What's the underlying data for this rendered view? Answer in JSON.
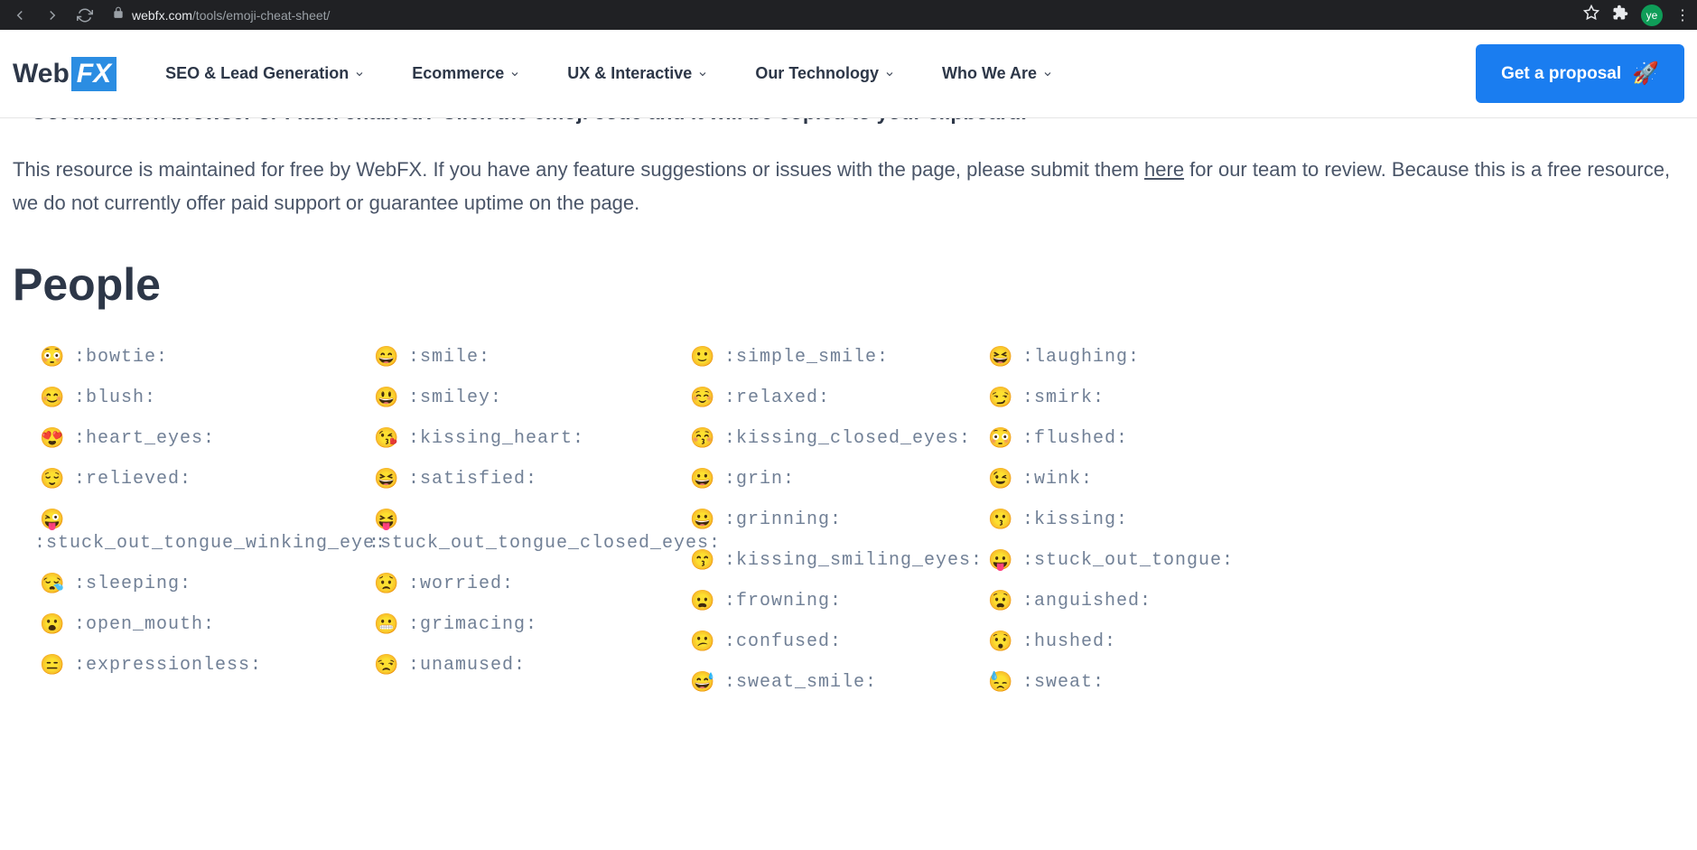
{
  "browser": {
    "url_domain": "webfx.com",
    "url_path": "/tools/emoji-cheat-sheet/",
    "avatar": "ye"
  },
  "header": {
    "logo_web": "Web",
    "logo_fx": "FX",
    "nav": [
      "SEO & Lead Generation",
      "Ecommerce",
      "UX & Interactive",
      "Our Technology",
      "Who We Are"
    ],
    "cta": "Get a proposal"
  },
  "content": {
    "clipped_text": "> Got a modern browser or Flash enabled? Click the emoji code and it will be copied to your clipboard.",
    "intro_part1": "This resource is maintained for free by WebFX. If you have any feature suggestions or issues with the page, please submit them ",
    "intro_link": "here",
    "intro_part2": " for our team to review. Because this is a free resource, we do not currently offer paid support or guarantee uptime on the page.",
    "heading": "People"
  },
  "emoji_columns": [
    [
      {
        "emoji": "😳",
        "code": ":bowtie:",
        "wrap": false
      },
      {
        "emoji": "😊",
        "code": ":blush:",
        "wrap": false
      },
      {
        "emoji": "😍",
        "code": ":heart_eyes:",
        "wrap": false
      },
      {
        "emoji": "😌",
        "code": ":relieved:",
        "wrap": false
      },
      {
        "emoji": "😜",
        "code": ":stuck_out_tongue_winking_eye:",
        "wrap": true
      },
      {
        "emoji": "😪",
        "code": ":sleeping:",
        "wrap": false
      },
      {
        "emoji": "😮",
        "code": ":open_mouth:",
        "wrap": false
      },
      {
        "emoji": "😑",
        "code": ":expressionless:",
        "wrap": false
      }
    ],
    [
      {
        "emoji": "😄",
        "code": ":smile:",
        "wrap": false
      },
      {
        "emoji": "😃",
        "code": ":smiley:",
        "wrap": false
      },
      {
        "emoji": "😘",
        "code": ":kissing_heart:",
        "wrap": false
      },
      {
        "emoji": "😆",
        "code": ":satisfied:",
        "wrap": false
      },
      {
        "emoji": "😝",
        "code": ":stuck_out_tongue_closed_eyes:",
        "wrap": true
      },
      {
        "emoji": "😟",
        "code": ":worried:",
        "wrap": false
      },
      {
        "emoji": "😬",
        "code": ":grimacing:",
        "wrap": false
      },
      {
        "emoji": "😒",
        "code": ":unamused:",
        "wrap": false
      }
    ],
    [
      {
        "emoji": "🙂",
        "code": ":simple_smile:",
        "wrap": false
      },
      {
        "emoji": "☺️",
        "code": ":relaxed:",
        "wrap": false
      },
      {
        "emoji": "😚",
        "code": ":kissing_closed_eyes:",
        "wrap": false
      },
      {
        "emoji": "😀",
        "code": ":grin:",
        "wrap": false
      },
      {
        "emoji": "😀",
        "code": ":grinning:",
        "wrap": false
      },
      {
        "emoji": "😙",
        "code": ":kissing_smiling_eyes:",
        "wrap": false
      },
      {
        "emoji": "😦",
        "code": ":frowning:",
        "wrap": false
      },
      {
        "emoji": "😕",
        "code": ":confused:",
        "wrap": false
      },
      {
        "emoji": "😅",
        "code": ":sweat_smile:",
        "wrap": false
      }
    ],
    [
      {
        "emoji": "😆",
        "code": ":laughing:",
        "wrap": false
      },
      {
        "emoji": "😏",
        "code": ":smirk:",
        "wrap": false
      },
      {
        "emoji": "😳",
        "code": ":flushed:",
        "wrap": false
      },
      {
        "emoji": "😉",
        "code": ":wink:",
        "wrap": false
      },
      {
        "emoji": "😗",
        "code": ":kissing:",
        "wrap": false
      },
      {
        "emoji": "😛",
        "code": ":stuck_out_tongue:",
        "wrap": false
      },
      {
        "emoji": "😧",
        "code": ":anguished:",
        "wrap": false
      },
      {
        "emoji": "😯",
        "code": ":hushed:",
        "wrap": false
      },
      {
        "emoji": "😓",
        "code": ":sweat:",
        "wrap": false
      }
    ]
  ]
}
